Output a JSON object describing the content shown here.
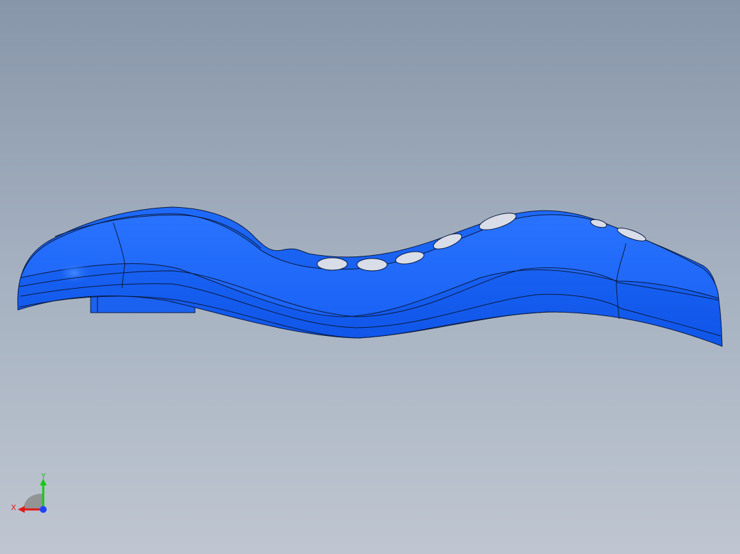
{
  "viewport": {
    "background_top": "#8796a9",
    "background_bottom": "#bfc6d1"
  },
  "model": {
    "name": "curved-blue-part",
    "color": "#1f6bff",
    "edge_color": "#0a1a40"
  },
  "triad": {
    "x_label": "X",
    "y_label": "Y",
    "x_color": "#e01818",
    "y_color": "#18c818",
    "z_color": "#2040ff"
  }
}
